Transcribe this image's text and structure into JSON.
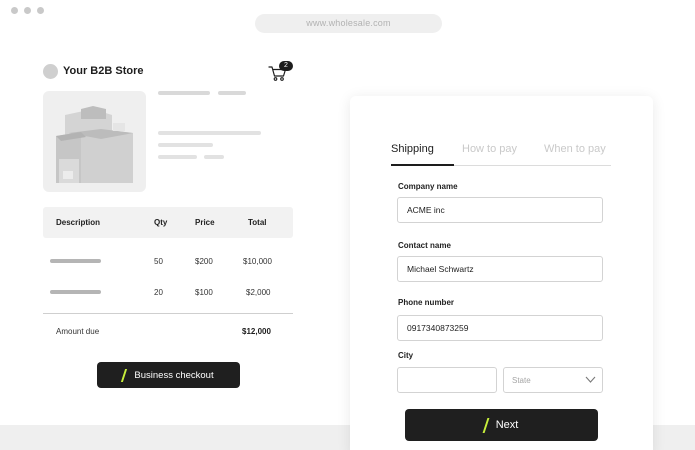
{
  "browser": {
    "url": "www.wholesale.com"
  },
  "store": {
    "name": "Your B2B Store",
    "cart_count": "2"
  },
  "table": {
    "headers": {
      "description": "Description",
      "qty": "Qty",
      "price": "Price",
      "total": "Total"
    },
    "rows": [
      {
        "qty": "50",
        "price": "$200",
        "total": "$10,000"
      },
      {
        "qty": "20",
        "price": "$100",
        "total": "$2,000"
      }
    ],
    "amount_due_label": "Amount due",
    "amount_due_value": "$12,000"
  },
  "checkout_button": {
    "label": "Business checkout"
  },
  "tabs": [
    {
      "label": "Shipping",
      "active": true
    },
    {
      "label": "How to pay",
      "active": false
    },
    {
      "label": "When to pay",
      "active": false
    }
  ],
  "form": {
    "company": {
      "label": "Company name",
      "value": "ACME inc"
    },
    "contact": {
      "label": "Contact name",
      "value": "Michael Schwartz"
    },
    "phone": {
      "label": "Phone number",
      "value": "0917340873259"
    },
    "city": {
      "label": "City",
      "value": ""
    },
    "state": {
      "placeholder": "State"
    }
  },
  "next_button": {
    "label": "Next"
  },
  "colors": {
    "dark": "#1f1f1f",
    "accent": "#c8ef3c",
    "placeholder": "#d9d9d9"
  },
  "icons": [
    "cart-icon",
    "chevron-down-icon",
    "product-image"
  ]
}
